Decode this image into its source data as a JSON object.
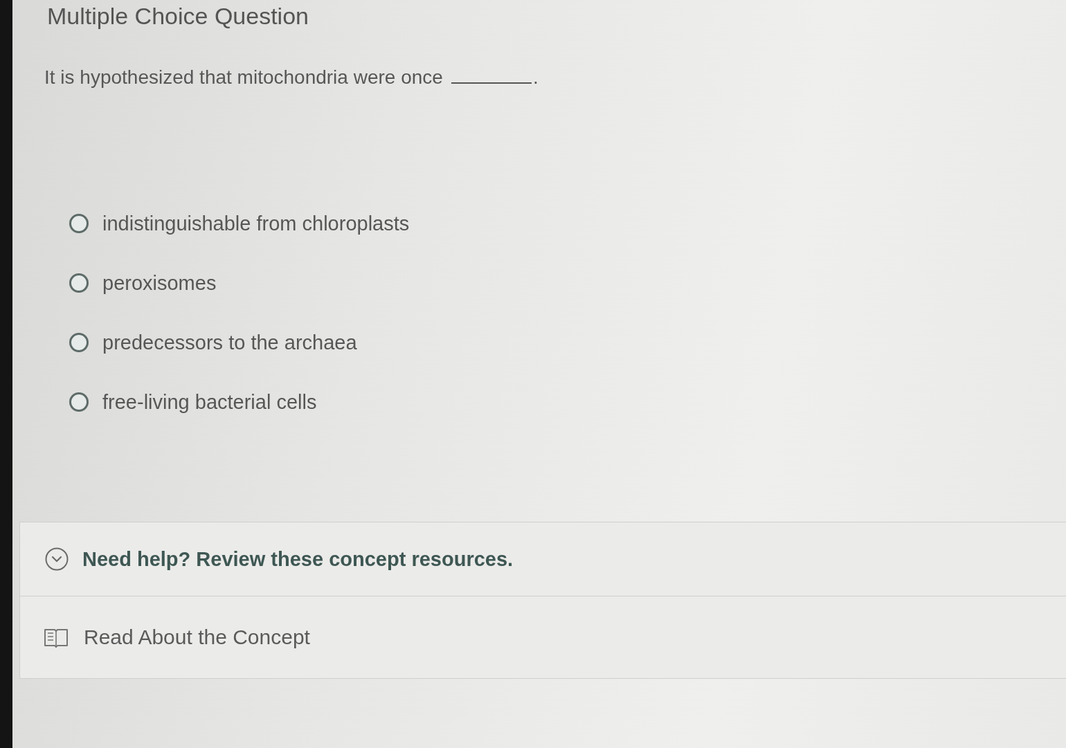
{
  "question": {
    "type_label": "Multiple Choice Question",
    "prompt": "It is hypothesized that mitochondria were once",
    "prompt_end": "."
  },
  "options": [
    {
      "label": "indistinguishable from chloroplasts",
      "selected": false
    },
    {
      "label": "peroxisomes",
      "selected": false
    },
    {
      "label": "predecessors to the archaea",
      "selected": false
    },
    {
      "label": "free-living bacterial cells",
      "selected": false
    }
  ],
  "help": {
    "heading": "Need help? Review these concept resources.",
    "resources": [
      {
        "label": "Read About the Concept"
      }
    ]
  }
}
